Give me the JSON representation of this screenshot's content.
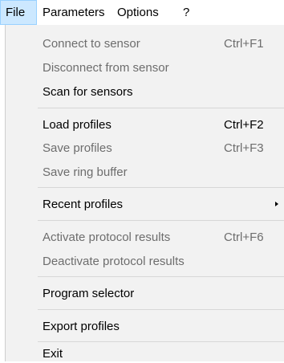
{
  "menubar": {
    "items": [
      {
        "label": "File",
        "active": true
      },
      {
        "label": "Parameters",
        "active": false
      },
      {
        "label": "Options",
        "active": false
      },
      {
        "label": "?",
        "active": false
      }
    ]
  },
  "file_menu": {
    "items": [
      {
        "label": "Connect to sensor",
        "shortcut": "Ctrl+F1",
        "enabled": false
      },
      {
        "label": "Disconnect from sensor",
        "shortcut": "",
        "enabled": false
      },
      {
        "label": "Scan for sensors",
        "shortcut": "",
        "enabled": true
      },
      {
        "label": "Load profiles",
        "shortcut": "Ctrl+F2",
        "enabled": true
      },
      {
        "label": "Save profiles",
        "shortcut": "Ctrl+F3",
        "enabled": false
      },
      {
        "label": "Save ring buffer",
        "shortcut": "",
        "enabled": false
      },
      {
        "label": "Recent profiles",
        "shortcut": "",
        "enabled": true,
        "submenu": true
      },
      {
        "label": "Activate protocol results",
        "shortcut": "Ctrl+F6",
        "enabled": false
      },
      {
        "label": "Deactivate protocol results",
        "shortcut": "",
        "enabled": false
      },
      {
        "label": "Program selector",
        "shortcut": "",
        "enabled": true
      },
      {
        "label": "Export profiles",
        "shortcut": "",
        "enabled": true
      },
      {
        "label": "Exit",
        "shortcut": "",
        "enabled": true
      }
    ]
  },
  "colors": {
    "menu_background": "#f2f2f2",
    "active_menubar_highlight": "#cce8ff",
    "active_menubar_border": "#99d1ff",
    "disabled_text": "#6d6d6d",
    "separator": "#d7d7d7"
  }
}
